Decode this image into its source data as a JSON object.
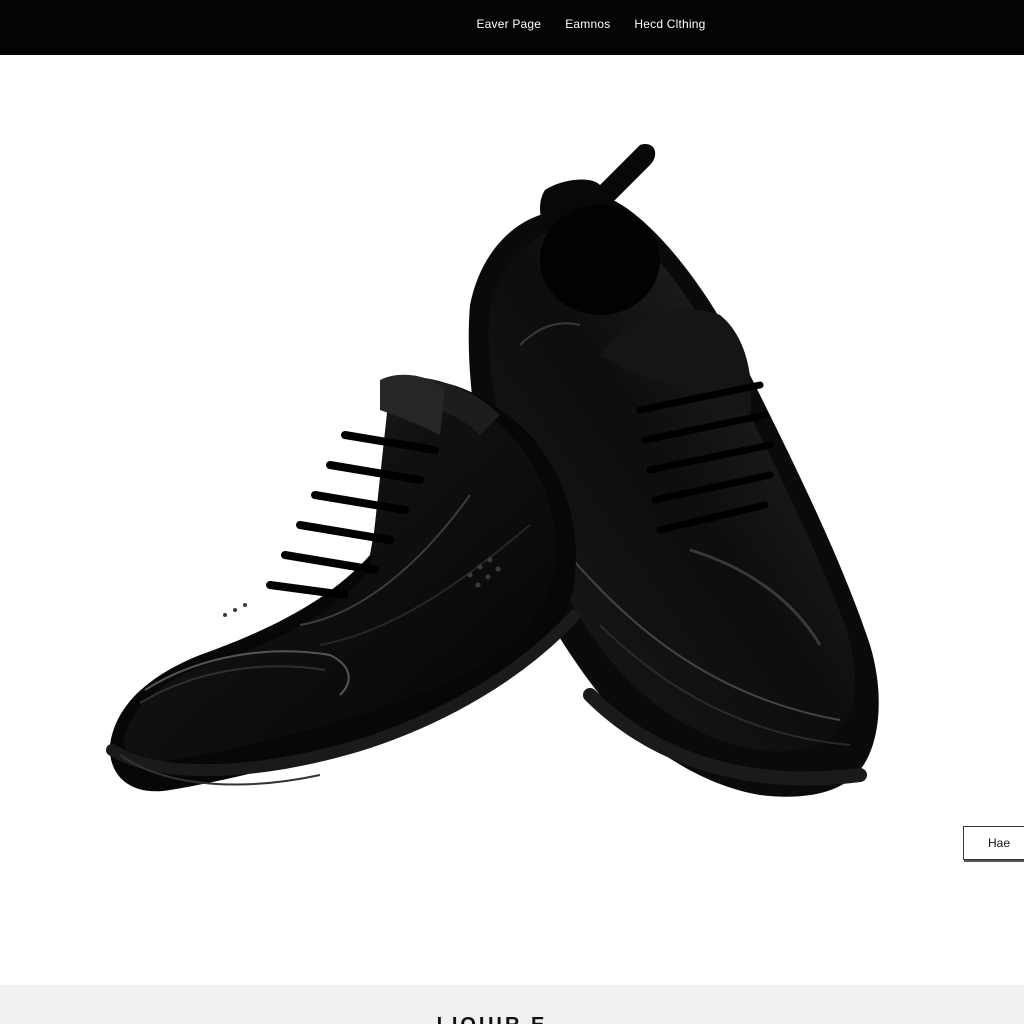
{
  "nav": {
    "links": [
      {
        "label": "Eaver Page"
      },
      {
        "label": "Eamnos"
      },
      {
        "label": "Hecd Clthing"
      }
    ]
  },
  "hero": {
    "image_icon": "black-leather-sneakers-product-photo",
    "colors": {
      "shoe": "#0b0b0b",
      "highlight": "#4a4a4a",
      "background": "#ffffff"
    }
  },
  "side_button": {
    "label": "Hae"
  },
  "footer": {
    "heading": "LIOUIR E"
  }
}
